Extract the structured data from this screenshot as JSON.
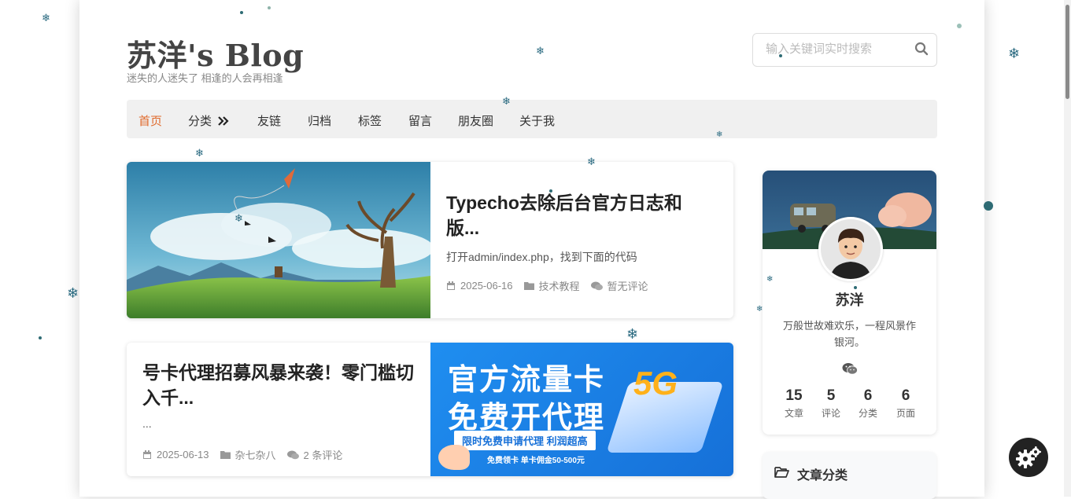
{
  "header": {
    "title": "苏洋's Blog",
    "subtitle": "迷失的人迷失了 相逢的人会再相逢"
  },
  "search": {
    "placeholder": "输入关键词实时搜索"
  },
  "nav": {
    "items": [
      "首页",
      "分类",
      "友链",
      "归档",
      "标签",
      "留言",
      "朋友圈",
      "关于我"
    ],
    "active": "首页",
    "accent_color": "#e06a2c"
  },
  "posts": [
    {
      "title": "Typecho去除后台官方日志和版...",
      "excerpt": "打开admin/index.php，找到下面的代码",
      "date": "2025-06-16",
      "category": "技术教程",
      "comments": "暂无评论"
    },
    {
      "title": "号卡代理招募风暴来袭！零门槛切入千...",
      "excerpt": "...",
      "date": "2025-06-13",
      "category": "杂七杂八",
      "comments": "2 条评论",
      "banner": {
        "line1": "官方流量卡",
        "line2": "免费开代理",
        "tag": "限时免费申请代理 利润超高",
        "note": "免费领卡 单卡佣金50-500元",
        "badge": "5G"
      }
    }
  ],
  "profile": {
    "name": "苏洋",
    "motto": "万般世故难欢乐，一程风景作银河。",
    "stats": [
      {
        "num": "15",
        "label": "文章"
      },
      {
        "num": "5",
        "label": "评论"
      },
      {
        "num": "6",
        "label": "分类"
      },
      {
        "num": "6",
        "label": "页面"
      }
    ]
  },
  "sidebar": {
    "category_heading": "文章分类"
  },
  "icons": {
    "search": "search-icon",
    "double_chevron": "double-chevron-right-icon",
    "calendar": "calendar-icon",
    "folder": "folder-icon",
    "comments": "comments-icon",
    "wechat": "wechat-icon",
    "folder_open": "folder-open-icon",
    "settings": "gears-icon",
    "snowflake": "snowflake-icon"
  }
}
